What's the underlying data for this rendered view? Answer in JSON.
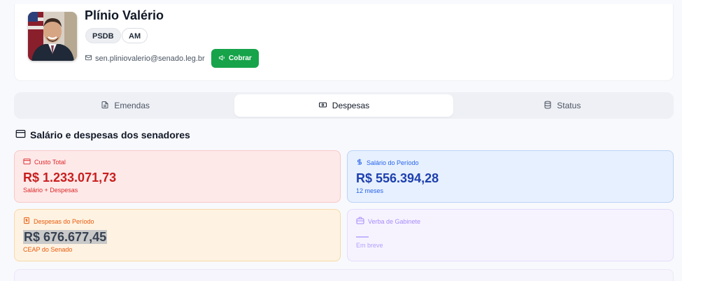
{
  "profile": {
    "name": "Plínio Valério",
    "party": "PSDB",
    "state": "AM",
    "email": "sen.pliniovalerio@senado.leg.br",
    "cobrar_label": "Cobrar"
  },
  "tabs": [
    {
      "label": "Emendas",
      "icon": "document-icon",
      "active": false
    },
    {
      "label": "Despesas",
      "icon": "banknote-icon",
      "active": true
    },
    {
      "label": "Status",
      "icon": "database-icon",
      "active": false
    }
  ],
  "section": {
    "title": "Salário e despesas dos senadores",
    "icon": "credit-card-icon"
  },
  "cards": {
    "total": {
      "label": "Custo Total",
      "value": "R$ 1.233.071,73",
      "sub": "Salário + Despesas",
      "icon": "credit-card-icon"
    },
    "salary": {
      "label": "Salário do Período",
      "value": "R$ 556.394,28",
      "sub": "12 meses",
      "icon": "dollar-icon"
    },
    "expenses": {
      "label": "Despesas do Período",
      "value": "R$ 676.677,45",
      "sub": "CEAP do Senado",
      "icon": "receipt-icon"
    },
    "cabinet": {
      "label": "Verba de Gabinete",
      "sub": "Em breve",
      "icon": "briefcase-icon"
    }
  },
  "colors": {
    "accent_green": "#16a34a",
    "total_red": "#c81e1e",
    "salary_blue": "#1e40af",
    "expenses_orange": "#ea580c",
    "cabinet_purple": "#a78bfa"
  }
}
